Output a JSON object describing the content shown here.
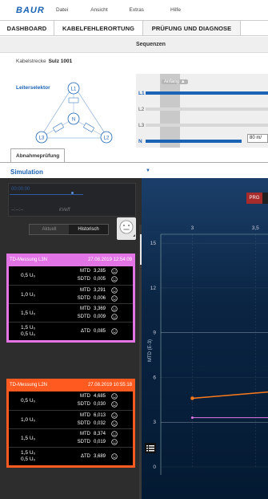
{
  "menubar": {
    "logo": "BAUR",
    "items": [
      "Datei",
      "Ansicht",
      "Extras",
      "Hilfe"
    ]
  },
  "nav": {
    "tabs": [
      "DASHBOARD",
      "KABELFEHLERORTUNG",
      "PRÜFUNG UND DIAGNOSE"
    ],
    "active": 2
  },
  "subheader": {
    "title": "Sequenzen"
  },
  "cable": {
    "label": "Kabelstrecke",
    "name": "Sulz 1001"
  },
  "conductor": {
    "label": "Leiterselektor",
    "nodes": [
      "L1",
      "N",
      "L3",
      "L2"
    ]
  },
  "sequence": {
    "anfang": "Anfang",
    "lanes": [
      "L1",
      "L2",
      "L3",
      "N"
    ],
    "distance": "80 m/"
  },
  "tabs": {
    "abnahme": "Abnahmeprüfung"
  },
  "simulation": {
    "label": "Simulation"
  },
  "mini": {
    "timer": "00:00:00",
    "axis": "--:--:--",
    "unit": "kVeff"
  },
  "toggle": {
    "aktuell": "Aktuell",
    "historisch": "Historisch"
  },
  "cards": [
    {
      "title": "TD-Messung   L3N",
      "date": "27.08.2019 12:54:09",
      "color": "#e374e6",
      "rows": [
        {
          "u": "0,5 U₀",
          "m": [
            [
              "MTD",
              "3,285"
            ],
            [
              "SDTD",
              "0,005"
            ]
          ]
        },
        {
          "u": "1,0 U₀",
          "m": [
            [
              "MTD",
              "3,291"
            ],
            [
              "SDTD",
              "0,006"
            ]
          ]
        },
        {
          "u": "1,5 U₀",
          "m": [
            [
              "MTD",
              "3,369"
            ],
            [
              "SDTD",
              "0,009"
            ]
          ]
        },
        {
          "u": "1,5 U₀\n0,5 U₀",
          "m": [
            [
              "ΔTD",
              "0,085"
            ]
          ]
        }
      ]
    },
    {
      "title": "TD-Messung   L2N",
      "date": "27.08.2019 10:55:18",
      "color": "#ff5a1f",
      "rows": [
        {
          "u": "0,5 U₀",
          "m": [
            [
              "MTD",
              "4,685"
            ],
            [
              "SDTD",
              "0,030"
            ]
          ]
        },
        {
          "u": "1,0 U₀",
          "m": [
            [
              "MTD",
              "6,013"
            ],
            [
              "SDTD",
              "0,032"
            ]
          ]
        },
        {
          "u": "1,5 U₀",
          "m": [
            [
              "MTD",
              "8,374"
            ],
            [
              "SDTD",
              "0,019"
            ]
          ]
        },
        {
          "u": "1,5 U₀\n0,5 U₀",
          "m": [
            [
              "ΔTD",
              "3,689"
            ]
          ]
        }
      ]
    }
  ],
  "chart": {
    "prg_label": "PRG",
    "x_ticks": [
      "3",
      "3,5"
    ],
    "y_ticks": [
      "15",
      "12",
      "9",
      "6",
      "3",
      "0"
    ],
    "ylabel": "MTD (E-3)"
  },
  "chart_data": {
    "type": "line",
    "ylabel": "MTD (E-3)",
    "y_ticks": [
      0,
      3,
      6,
      9,
      12,
      15
    ],
    "x_ticks": [
      3,
      3.5
    ],
    "series": [
      {
        "color": "#ff7a1a",
        "points": [
          {
            "y": 4.6
          },
          {
            "y": 5.2
          }
        ]
      },
      {
        "color": "#e374e6",
        "points": [
          {
            "y": 3.3
          },
          {
            "y": 3.3
          }
        ]
      }
    ]
  }
}
